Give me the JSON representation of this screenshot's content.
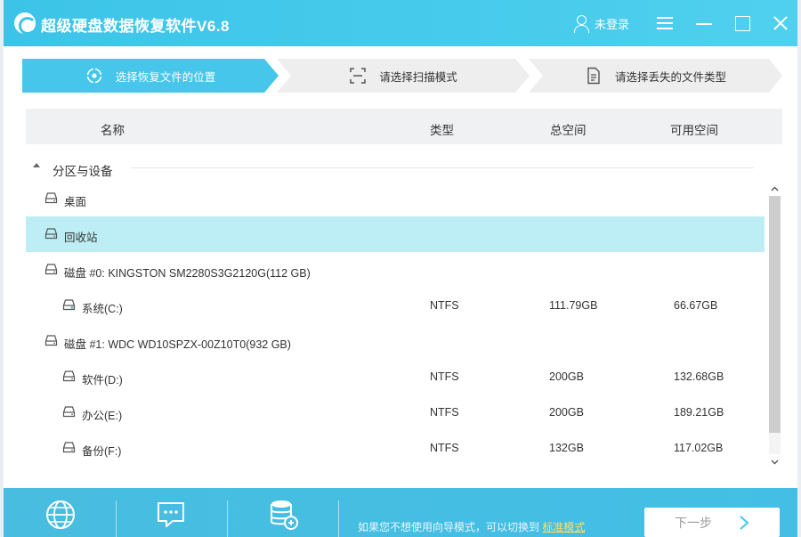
{
  "window": {
    "title": "超级硬盘数据恢复软件V6.8",
    "login_label": "未登录"
  },
  "steps": [
    {
      "label": "选择恢复文件的位置",
      "active": true
    },
    {
      "label": "请选择扫描模式",
      "active": false
    },
    {
      "label": "请选择丢失的文件类型",
      "active": false
    }
  ],
  "table": {
    "columns": [
      "名称",
      "类型",
      "总空间",
      "可用空间"
    ],
    "group_label": "分区与设备",
    "rows": [
      {
        "name": "桌面",
        "type": "",
        "total": "",
        "free": "",
        "selected": false
      },
      {
        "name": "回收站",
        "type": "",
        "total": "",
        "free": "",
        "selected": true
      },
      {
        "name": "磁盘 #0: KINGSTON SM2280S3G2120G(112 GB)",
        "type": "",
        "total": "",
        "free": "",
        "selected": false
      },
      {
        "name": "系统(C:)",
        "type": "NTFS",
        "total": "111.79GB",
        "free": "66.67GB",
        "selected": false
      },
      {
        "name": "磁盘 #1: WDC WD10SPZX-00Z10T0(932 GB)",
        "type": "",
        "total": "",
        "free": "",
        "selected": false
      },
      {
        "name": "软件(D:)",
        "type": "NTFS",
        "total": "200GB",
        "free": "132.68GB",
        "selected": false
      },
      {
        "name": "办公(E:)",
        "type": "NTFS",
        "total": "200GB",
        "free": "189.21GB",
        "selected": false
      },
      {
        "name": "备份(F:)",
        "type": "NTFS",
        "total": "132GB",
        "free": "117.02GB",
        "selected": false
      }
    ]
  },
  "footer": {
    "hint_text": "如果您不想使用向导模式，可以切换到",
    "hint_link": "标准模式",
    "next_label": "下一步"
  },
  "colors": {
    "accent": "#3cc4e8",
    "selected_row": "#bdeef5",
    "footer": "#48bde0",
    "link": "#ffe066"
  },
  "icons": [
    "app-logo-icon",
    "user-icon",
    "menu-icon",
    "minimize-icon",
    "maximize-icon",
    "close-icon",
    "location-icon",
    "scan-icon",
    "document-icon",
    "drive-icon",
    "globe-icon",
    "chat-icon",
    "database-icon",
    "arrow-right-icon"
  ]
}
